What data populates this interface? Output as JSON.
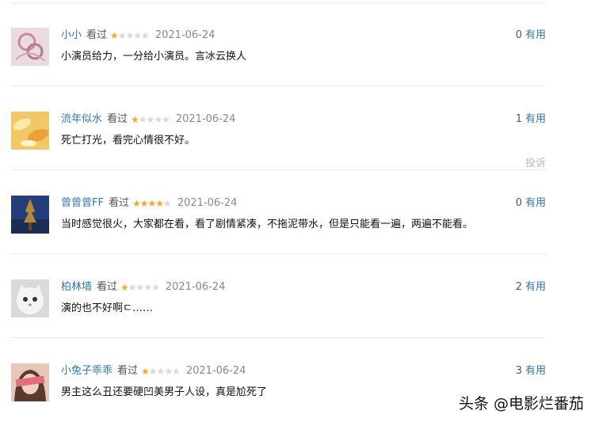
{
  "reviews": [
    {
      "user": "小小",
      "watched": "看过",
      "stars": 1,
      "date": "2021-06-24",
      "useful_count": "0",
      "useful_label": "有用",
      "content": "小演员给力，一分给小演员。言冰云换人"
    },
    {
      "user": "流年似水",
      "watched": "看过",
      "stars": 1,
      "date": "2021-06-24",
      "useful_count": "1",
      "useful_label": "有用",
      "content": "死亡打光，看完心情很不好。",
      "report": "投诉"
    },
    {
      "user": "曾曾曾FF",
      "watched": "看过",
      "stars": 4,
      "date": "2021-06-24",
      "useful_count": "0",
      "useful_label": "有用",
      "content": "当时感觉很火，大家都在看，看了剧情紧凑，不拖泥带水，但是只能看一遍，两遍不能看。"
    },
    {
      "user": "柏林墙",
      "watched": "看过",
      "stars": 1,
      "date": "2021-06-24",
      "useful_count": "2",
      "useful_label": "有用",
      "content": "演的也不好啊ㄷ……"
    },
    {
      "user": "小兔子乖乖",
      "watched": "看过",
      "stars": 1,
      "date": "2021-06-24",
      "useful_count": "3",
      "useful_label": "有用",
      "content": "男主这么丑还要硬凹美男子人设，真是尬死了"
    }
  ],
  "watermark": "头条 @电影烂番茄",
  "colors": {
    "username": "#3377aa",
    "star_on": "#f5a623",
    "star_off": "#d8d8d8",
    "divider": "#ececec"
  }
}
